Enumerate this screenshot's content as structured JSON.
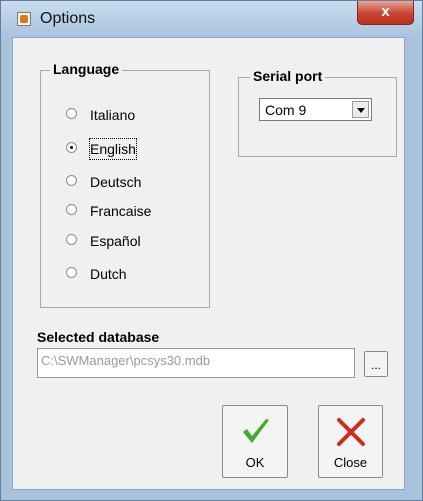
{
  "window": {
    "title": "Options",
    "close_label": "x"
  },
  "language": {
    "legend": "Language",
    "options": [
      "Italiano",
      "English",
      "Deutsch",
      "Francaise",
      "Español",
      "Dutch"
    ],
    "selected": "English"
  },
  "serial_port": {
    "legend": "Serial port",
    "value": "Com 9"
  },
  "database": {
    "label": "Selected database",
    "path": "C:\\SWManager\\pcsys30.mdb",
    "browse_label": "..."
  },
  "buttons": {
    "ok_label": "OK",
    "close_label": "Close"
  },
  "colors": {
    "ok_icon": "#3fae2a",
    "close_icon": "#d12a1c"
  },
  "icons": {
    "app": "app-icon",
    "ok": "checkmark-icon",
    "close": "x-icon"
  }
}
